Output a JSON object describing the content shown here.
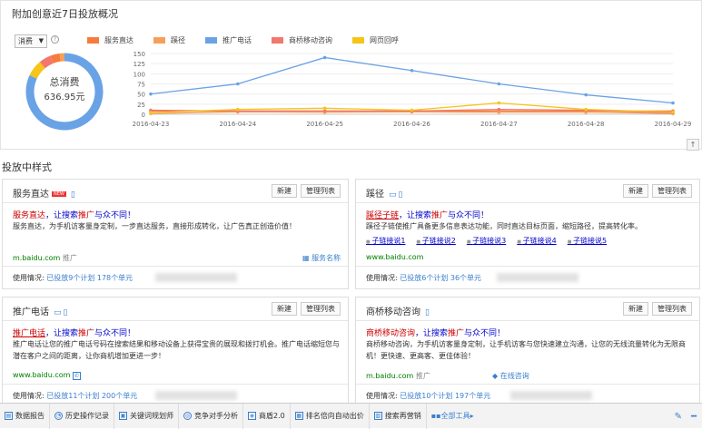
{
  "top_panel": {
    "title": "附加创意近7日投放概况",
    "metric_select": "消费",
    "help": "?",
    "total_label": "总消费",
    "total_value": "636.95元",
    "legend": [
      {
        "name": "服务直达",
        "color": "#f57c3c"
      },
      {
        "name": "蹊径",
        "color": "#f5a05a"
      },
      {
        "name": "推广电话",
        "color": "#6aa2e6"
      },
      {
        "name": "商桥移动咨询",
        "color": "#f2786e"
      },
      {
        "name": "网页回呼",
        "color": "#f5c518"
      }
    ],
    "expand_icon": "↑"
  },
  "chart_data": {
    "type": "line",
    "x": [
      "2016-04-23",
      "2016-04-24",
      "2016-04-25",
      "2016-04-26",
      "2016-04-27",
      "2016-04-28",
      "2016-04-29"
    ],
    "ylim": [
      0,
      150
    ],
    "yticks": [
      0,
      25,
      50,
      75,
      100,
      125,
      150
    ],
    "series": [
      {
        "name": "服务直达",
        "color": "#f57c3c",
        "values": [
          8,
          8,
          8,
          8,
          8,
          8,
          8
        ]
      },
      {
        "name": "蹊径",
        "color": "#f5a05a",
        "values": [
          2,
          6,
          5,
          6,
          5,
          5,
          2
        ]
      },
      {
        "name": "推广电话",
        "color": "#6aa2e6",
        "values": [
          50,
          75,
          140,
          108,
          75,
          48,
          28
        ]
      },
      {
        "name": "商桥移动咨询",
        "color": "#f2786e",
        "values": [
          10,
          8,
          8,
          8,
          12,
          10,
          3
        ]
      },
      {
        "name": "网页回呼",
        "color": "#f5c518",
        "values": [
          4,
          12,
          15,
          10,
          28,
          12,
          5
        ]
      }
    ],
    "donut": [
      {
        "name": "推广电话",
        "color": "#6aa2e6",
        "share": 0.82
      },
      {
        "name": "网页回呼",
        "color": "#f5c518",
        "share": 0.07
      },
      {
        "name": "商桥移动咨询",
        "color": "#f2786e",
        "share": 0.05
      },
      {
        "name": "服务直达",
        "color": "#f57c3c",
        "share": 0.04
      },
      {
        "name": "蹊径",
        "color": "#f5a05a",
        "share": 0.02
      }
    ]
  },
  "section_title": "投放中样式",
  "buttons": {
    "new": "新建",
    "manage": "管理列表"
  },
  "cards": {
    "service": {
      "title": "服务直达",
      "badge": "NEW",
      "ad_title_a": "服务直达",
      "ad_title_b": "，让搜索",
      "ad_title_c": "推广",
      "ad_title_d": "与众不同！",
      "desc": "服务直达，为手机访客量身定制，一步直达服务，直接形成转化，让广告真正创造价值！",
      "url": "m.baidu.com",
      "url_tag": "推广",
      "ext": "服务名称",
      "usage_label": "使用情况:",
      "usage_link": "已投放9个计划 178个单元"
    },
    "path": {
      "title": "蹊径",
      "ad_title_a": "蹊径子链",
      "ad_title_b": "，让搜索",
      "ad_title_c": "推广",
      "ad_title_d": "与众不同！",
      "desc": "蹊径子链使推广具备更多信息表达功能，同时直达目标页面，缩短路径，提高转化率。",
      "sitelinks": [
        "子链接说1",
        "子链接说2",
        "子链接说3",
        "子链接说4",
        "子链接说5"
      ],
      "url": "www.baidu.com",
      "usage_label": "使用情况:",
      "usage_link": "已投放6个计划 36个单元"
    },
    "phone": {
      "title": "推广电话",
      "ad_title_a": "推广电话",
      "ad_title_b": "，让搜索",
      "ad_title_c": "推广",
      "ad_title_d": "与众不同！",
      "desc": "推广电话让您的推广电话号码在搜索结果和移动设备上获得宝贵的展现和拨打机会。推广电话缩短您与潜在客户之间的距离，让你商机增加更进一步！",
      "url": "www.baidu.com",
      "usage_label": "使用情况:",
      "usage_link": "已投放11个计划 200个单元"
    },
    "bridge": {
      "title": "商桥移动咨询",
      "ad_title_a": "商桥移动咨询",
      "ad_title_b": "，让搜索",
      "ad_title_c": "推广",
      "ad_title_d": "与众不同！",
      "desc": "商桥移动咨询，为手机访客量身定制，让手机访客与您快速建立沟通，让您的无线流量转化为无限商机！更快速、更高客、更佳体验！",
      "url": "m.baidu.com",
      "url_tag": "推广",
      "ext": "在线咨询",
      "usage_label": "使用情况:",
      "usage_link": "已投放10个计划 197个单元"
    }
  },
  "bottom_bar": {
    "tools": [
      "数据报告",
      "历史操作记录",
      "关键词规划师",
      "竞争对手分析",
      "商盾2.0",
      "排名倍向自动出价",
      "搜索再营销"
    ],
    "all_tools": "全部工具"
  }
}
